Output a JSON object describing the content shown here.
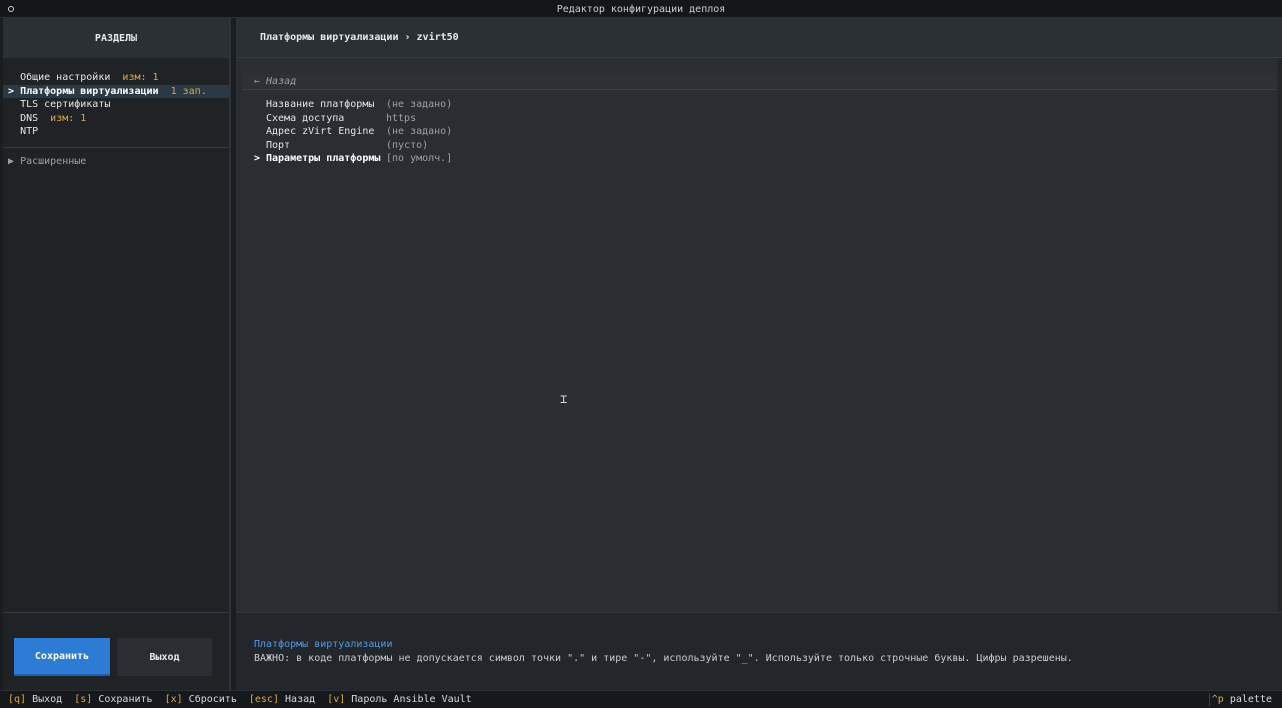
{
  "window": {
    "title": "Редактор конфигурации деплоя"
  },
  "sidebar": {
    "header": "РАЗДЕЛЫ",
    "items": [
      {
        "marker": " ",
        "label": "Общие настройки",
        "badge": "изм: 1"
      },
      {
        "marker": ">",
        "label": "Платформы виртуализации",
        "badge": "1 зап."
      },
      {
        "marker": " ",
        "label": "TLS сертификаты",
        "badge": ""
      },
      {
        "marker": " ",
        "label": "DNS",
        "badge": "изм: 1"
      },
      {
        "marker": " ",
        "label": "NTP",
        "badge": ""
      }
    ],
    "advanced": {
      "marker": "▶",
      "label": "Расширенные"
    }
  },
  "main": {
    "breadcrumb": "Платформы виртуализации › zvirt50",
    "back": "← Назад",
    "fields": [
      {
        "marker": "",
        "label": "Название платформы",
        "value": "(не задано)"
      },
      {
        "marker": "",
        "label": "Схема доступа",
        "value": "https"
      },
      {
        "marker": "",
        "label": "Адрес zVirt Engine",
        "value": "(не задано)"
      },
      {
        "marker": "",
        "label": "Порт",
        "value": "(пусто)"
      },
      {
        "marker": ">",
        "label": "Параметры платформы",
        "value": "[по умолч.]"
      }
    ]
  },
  "buttons": {
    "save": "Сохранить",
    "exit": "Выход"
  },
  "help": {
    "title": "Платформы виртуализации",
    "text": "ВАЖНО: в коде платформы не допускается символ точки \".\" и тире \"-\", используйте \"_\". Используйте только строчные буквы. Цифры разрешены."
  },
  "footer": {
    "shortcuts": [
      {
        "key": "[q]",
        "label": "Выход"
      },
      {
        "key": "[s]",
        "label": "Сохранить"
      },
      {
        "key": "[x]",
        "label": "Сбросить"
      },
      {
        "key": "[esc]",
        "label": "Назад"
      },
      {
        "key": "[v]",
        "label": "Пароль Ansible Vault"
      }
    ],
    "palette_key": "^p",
    "palette_label": "palette"
  },
  "colors": {
    "accent": "#2e7bd6",
    "badge": "#e0a64a",
    "help_title": "#4e9ae6"
  }
}
